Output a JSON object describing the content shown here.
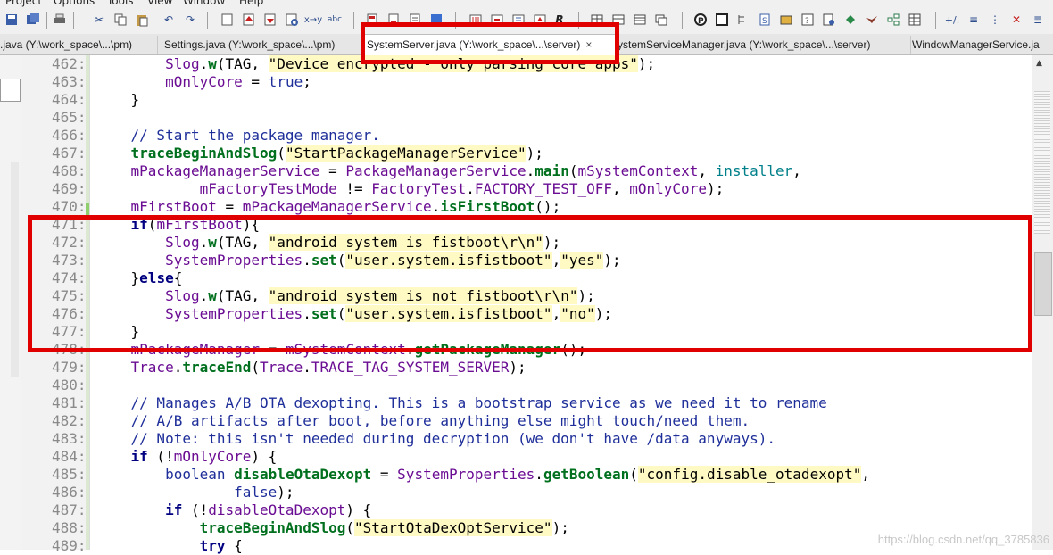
{
  "menu": [
    "Project",
    "Options",
    "Tools",
    "View",
    "Window",
    "Help"
  ],
  "tabs": [
    {
      "label": ".java (Y:\\work_space\\...\\pm)",
      "active": false
    },
    {
      "label": "Settings.java (Y:\\work_space\\...\\pm)",
      "active": false
    },
    {
      "label": "SystemServer.java (Y:\\work_space\\...\\server)",
      "active": true,
      "close": "×"
    },
    {
      "label": "ystemServiceManager.java (Y:\\work_space\\...\\server)",
      "active": false
    },
    {
      "label": "WindowManagerService.ja",
      "active": false
    }
  ],
  "code_lines": [
    {
      "n": "462:",
      "segments": [
        [
          "indent",
          "        "
        ],
        [
          "fld",
          "Slog"
        ],
        [
          "p",
          "."
        ],
        [
          "fn",
          "w"
        ],
        [
          "p",
          "(TAG, "
        ],
        [
          "str",
          "\"Device encrypted - only parsing core apps\""
        ],
        [
          "p",
          ");"
        ]
      ]
    },
    {
      "n": "463:",
      "segments": [
        [
          "indent",
          "        "
        ],
        [
          "fld",
          "mOnlyCore"
        ],
        [
          "p",
          " = "
        ],
        [
          "kwp",
          "true"
        ],
        [
          "p",
          ";"
        ]
      ]
    },
    {
      "n": "464:",
      "segments": [
        [
          "indent",
          "    "
        ],
        [
          "p",
          "}"
        ]
      ]
    },
    {
      "n": "465:",
      "segments": []
    },
    {
      "n": "466:",
      "segments": [
        [
          "indent",
          "    "
        ],
        [
          "cmt",
          "// Start the package manager."
        ]
      ]
    },
    {
      "n": "467:",
      "segments": [
        [
          "indent",
          "    "
        ],
        [
          "fn",
          "traceBeginAndSlog"
        ],
        [
          "p",
          "("
        ],
        [
          "str",
          "\"StartPackageManagerService\""
        ],
        [
          "p",
          ");"
        ]
      ]
    },
    {
      "n": "468:",
      "segments": [
        [
          "indent",
          "    "
        ],
        [
          "fld",
          "mPackageManagerService"
        ],
        [
          "p",
          " = "
        ],
        [
          "fld",
          "PackageManagerService"
        ],
        [
          "p",
          "."
        ],
        [
          "fn",
          "main"
        ],
        [
          "p",
          "("
        ],
        [
          "fld",
          "mSystemContext"
        ],
        [
          "p",
          ", "
        ],
        [
          "teal",
          "installer"
        ],
        [
          "p",
          ","
        ]
      ]
    },
    {
      "n": "469:",
      "segments": [
        [
          "indent",
          "            "
        ],
        [
          "fld",
          "mFactoryTestMode"
        ],
        [
          "p",
          " != "
        ],
        [
          "fld",
          "FactoryTest"
        ],
        [
          "p",
          "."
        ],
        [
          "fld",
          "FACTORY_TEST_OFF"
        ],
        [
          "p",
          ", "
        ],
        [
          "fld",
          "mOnlyCore"
        ],
        [
          "p",
          ");"
        ]
      ]
    },
    {
      "n": "470:",
      "segments": [
        [
          "indent",
          "    "
        ],
        [
          "fld",
          "mFirstBoot"
        ],
        [
          "p",
          " = "
        ],
        [
          "fld",
          "mPackageManagerService"
        ],
        [
          "p",
          "."
        ],
        [
          "fn",
          "isFirstBoot"
        ],
        [
          "p",
          "();"
        ]
      ]
    },
    {
      "n": "471:",
      "segments": [
        [
          "indent",
          "    "
        ],
        [
          "kw",
          "if"
        ],
        [
          "p",
          "("
        ],
        [
          "fld",
          "mFirstBoot"
        ],
        [
          "p",
          "){"
        ]
      ]
    },
    {
      "n": "472:",
      "segments": [
        [
          "indent",
          "        "
        ],
        [
          "fld",
          "Slog"
        ],
        [
          "p",
          "."
        ],
        [
          "fn",
          "w"
        ],
        [
          "p",
          "(TAG, "
        ],
        [
          "str",
          "\"android system is fistboot\\r\\n\""
        ],
        [
          "p",
          ");"
        ]
      ]
    },
    {
      "n": "473:",
      "segments": [
        [
          "indent",
          "        "
        ],
        [
          "fld",
          "SystemProperties"
        ],
        [
          "p",
          "."
        ],
        [
          "fn",
          "set"
        ],
        [
          "p",
          "("
        ],
        [
          "str",
          "\"user.system.isfistboot\""
        ],
        [
          "p",
          ","
        ],
        [
          "str",
          "\"yes\""
        ],
        [
          "p",
          ");"
        ]
      ]
    },
    {
      "n": "474:",
      "segments": [
        [
          "indent",
          "    "
        ],
        [
          "p",
          "}"
        ],
        [
          "kw",
          "else"
        ],
        [
          "p",
          "{"
        ]
      ]
    },
    {
      "n": "475:",
      "segments": [
        [
          "indent",
          "        "
        ],
        [
          "fld",
          "Slog"
        ],
        [
          "p",
          "."
        ],
        [
          "fn",
          "w"
        ],
        [
          "p",
          "(TAG, "
        ],
        [
          "str",
          "\"android system is not fistboot\\r\\n\""
        ],
        [
          "p",
          ");"
        ]
      ]
    },
    {
      "n": "476:",
      "segments": [
        [
          "indent",
          "        "
        ],
        [
          "fld",
          "SystemProperties"
        ],
        [
          "p",
          "."
        ],
        [
          "fn",
          "set"
        ],
        [
          "p",
          "("
        ],
        [
          "str",
          "\"user.system.isfistboot\""
        ],
        [
          "p",
          ","
        ],
        [
          "str",
          "\"no\""
        ],
        [
          "p",
          ");"
        ]
      ]
    },
    {
      "n": "477:",
      "segments": [
        [
          "indent",
          "    "
        ],
        [
          "p",
          "}"
        ]
      ]
    },
    {
      "n": "478:",
      "segments": [
        [
          "indent",
          "    "
        ],
        [
          "fld",
          "mPackageManager"
        ],
        [
          "p",
          " = "
        ],
        [
          "fld",
          "mSystemContext"
        ],
        [
          "p",
          "."
        ],
        [
          "fn",
          "getPackageManager"
        ],
        [
          "p",
          "();"
        ]
      ]
    },
    {
      "n": "479:",
      "segments": [
        [
          "indent",
          "    "
        ],
        [
          "fld",
          "Trace"
        ],
        [
          "p",
          "."
        ],
        [
          "fn",
          "traceEnd"
        ],
        [
          "p",
          "("
        ],
        [
          "fld",
          "Trace"
        ],
        [
          "p",
          "."
        ],
        [
          "fld",
          "TRACE_TAG_SYSTEM_SERVER"
        ],
        [
          "p",
          ");"
        ]
      ]
    },
    {
      "n": "480:",
      "segments": []
    },
    {
      "n": "481:",
      "segments": [
        [
          "indent",
          "    "
        ],
        [
          "cmt",
          "// Manages A/B OTA dexopting. This is a bootstrap service as we need it to rename"
        ]
      ]
    },
    {
      "n": "482:",
      "segments": [
        [
          "indent",
          "    "
        ],
        [
          "cmt",
          "// A/B artifacts after boot, before anything else might touch/need them."
        ]
      ]
    },
    {
      "n": "483:",
      "segments": [
        [
          "indent",
          "    "
        ],
        [
          "cmt",
          "// Note: this isn't needed during decryption (we don't have /data anyways)."
        ]
      ]
    },
    {
      "n": "484:",
      "segments": [
        [
          "indent",
          "    "
        ],
        [
          "kw",
          "if"
        ],
        [
          "p",
          " (!"
        ],
        [
          "fld",
          "mOnlyCore"
        ],
        [
          "p",
          ") {"
        ]
      ]
    },
    {
      "n": "485:",
      "segments": [
        [
          "indent",
          "        "
        ],
        [
          "kwp",
          "boolean"
        ],
        [
          "p",
          " "
        ],
        [
          "fnb",
          "disableOtaDexopt"
        ],
        [
          "p",
          " = "
        ],
        [
          "fld",
          "SystemProperties"
        ],
        [
          "p",
          "."
        ],
        [
          "fn",
          "getBoolean"
        ],
        [
          "p",
          "("
        ],
        [
          "str",
          "\"config.disable_otadexopt\""
        ],
        [
          "p",
          ","
        ]
      ]
    },
    {
      "n": "486:",
      "segments": [
        [
          "indent",
          "                "
        ],
        [
          "kwp",
          "false"
        ],
        [
          "p",
          ");"
        ]
      ]
    },
    {
      "n": "487:",
      "segments": [
        [
          "indent",
          "        "
        ],
        [
          "kw",
          "if"
        ],
        [
          "p",
          " (!"
        ],
        [
          "fld",
          "disableOtaDexopt"
        ],
        [
          "p",
          ") {"
        ]
      ]
    },
    {
      "n": "488:",
      "segments": [
        [
          "indent",
          "            "
        ],
        [
          "fn",
          "traceBeginAndSlog"
        ],
        [
          "p",
          "("
        ],
        [
          "str",
          "\"StartOtaDexOptService\""
        ],
        [
          "p",
          ");"
        ]
      ]
    },
    {
      "n": "489:",
      "segments": [
        [
          "indent",
          "            "
        ],
        [
          "kw",
          "try"
        ],
        [
          "p",
          " {"
        ]
      ]
    }
  ],
  "watermark": "https://blog.csdn.net/qq_3785836",
  "colors": {
    "annotation_red": "#e10000",
    "string_highlight": "#fff9c4"
  }
}
